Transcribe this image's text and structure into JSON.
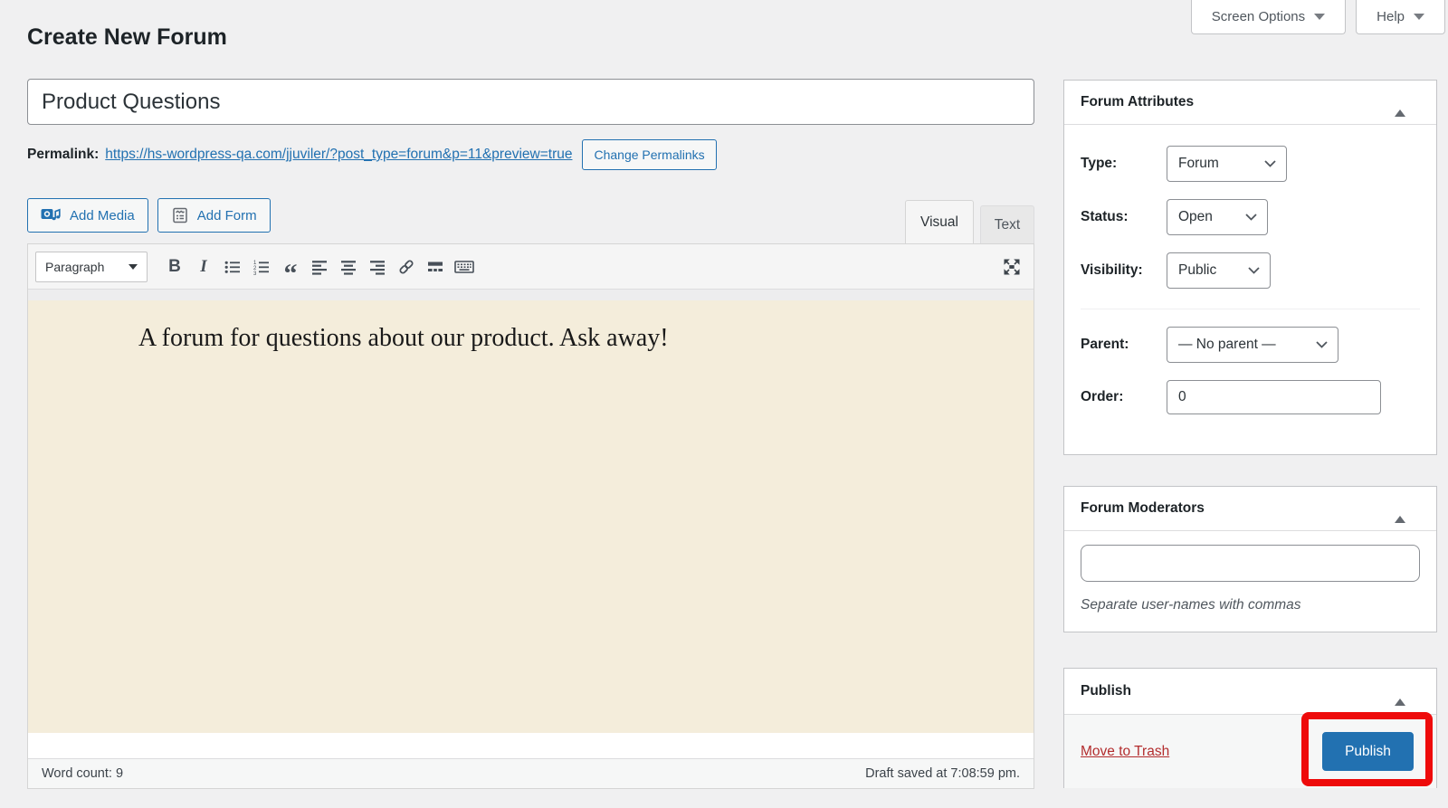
{
  "page": {
    "title": "Create New Forum",
    "screen_options_label": "Screen Options",
    "help_label": "Help"
  },
  "title_field": {
    "value": "Product Questions"
  },
  "permalink": {
    "label": "Permalink:",
    "url": "https://hs-wordpress-qa.com/jjuviler/?post_type=forum&p=11&preview=true",
    "change_button": "Change Permalinks"
  },
  "media_buttons": {
    "add_media": "Add Media",
    "add_form": "Add Form"
  },
  "editor": {
    "tabs": {
      "visual": "Visual",
      "text": "Text"
    },
    "toolbar": {
      "paragraph": "Paragraph",
      "bold": "B",
      "italic": "I"
    },
    "content": "A forum for questions about our product. Ask away!",
    "word_count_label": "Word count:",
    "word_count": "9",
    "draft_saved": "Draft saved at 7:08:59 pm."
  },
  "forum_attributes": {
    "title": "Forum Attributes",
    "type_label": "Type:",
    "type_value": "Forum",
    "status_label": "Status:",
    "status_value": "Open",
    "visibility_label": "Visibility:",
    "visibility_value": "Public",
    "parent_label": "Parent:",
    "parent_value": "— No parent —",
    "order_label": "Order:",
    "order_value": "0"
  },
  "forum_moderators": {
    "title": "Forum Moderators",
    "input_value": "",
    "hint": "Separate user-names with commas"
  },
  "publish_panel": {
    "title": "Publish",
    "move_to_trash": "Move to Trash",
    "publish_button": "Publish"
  },
  "colors": {
    "accent_blue": "#2271b1",
    "trash_red": "#b32d2e",
    "annotation_red": "#ee0b0b",
    "editor_background": "#f4eddb",
    "page_background": "#f0f0f1"
  }
}
